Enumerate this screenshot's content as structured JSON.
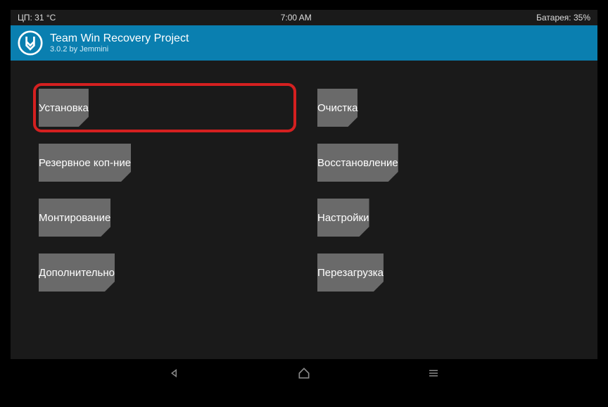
{
  "statusbar": {
    "cpu": "ЦП: 31 °C",
    "time": "7:00 AM",
    "battery": "Батарея: 35%"
  },
  "header": {
    "title": "Team Win Recovery Project",
    "subtitle": "3.0.2 by Jemmini"
  },
  "buttons": {
    "install": "Установка",
    "wipe": "Очистка",
    "backup": "Резервное коп-ние",
    "restore": "Восстановление",
    "mount": "Монтирование",
    "settings": "Настройки",
    "advanced": "Дополнительно",
    "reboot": "Перезагрузка"
  }
}
